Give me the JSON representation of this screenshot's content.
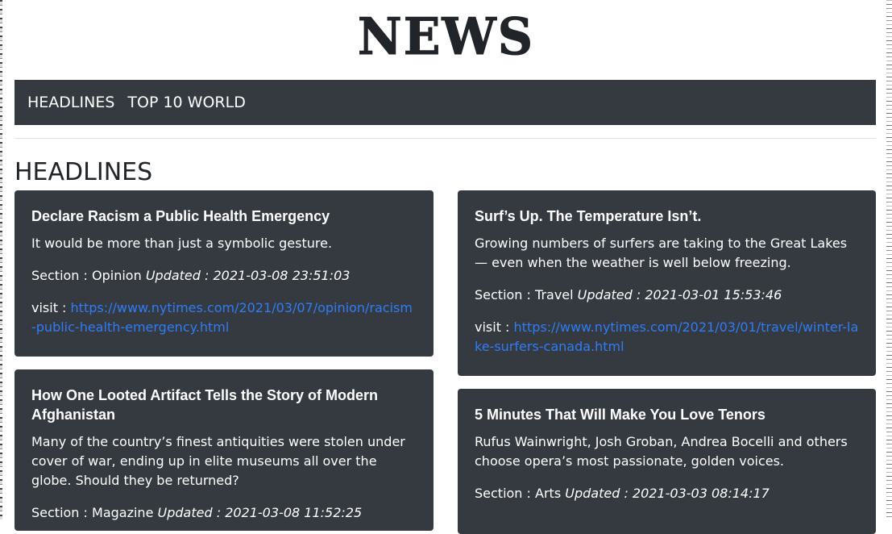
{
  "site": {
    "logo": "NEWS"
  },
  "nav": {
    "items": [
      "HEADLINES",
      "TOP 10 WORLD"
    ]
  },
  "page": {
    "title": "HEADLINES"
  },
  "labels": {
    "section_prefix": "Section : ",
    "updated_prefix": "Updated : ",
    "visit_prefix": "visit : "
  },
  "articles": [
    {
      "title": "Declare Racism a Public Health Emergency",
      "abstract": "It would be more than just a symbolic gesture.",
      "section": "Opinion",
      "updated": "2021-03-08 23:51:03",
      "url": "https://www.nytimes.com/2021/03/07/opinion/racism-public-health-emergency.html"
    },
    {
      "title": "Surf’s Up. The Temperature Isn’t.",
      "abstract": "Growing numbers of surfers are taking to the Great Lakes — even when the weather is well below freezing.",
      "section": "Travel",
      "updated": "2021-03-01 15:53:46",
      "url": "https://www.nytimes.com/2021/03/01/travel/winter-lake-surfers-canada.html"
    },
    {
      "title": "How One Looted Artifact Tells the Story of Modern Afghanistan",
      "abstract": "Many of the country’s finest antiquities were stolen under cover of war, ending up in elite museums all over the globe. Should they be returned?",
      "section": "Magazine",
      "updated": "2021-03-08 11:52:25"
    },
    {
      "title": "5 Minutes That Will Make You Love Tenors",
      "abstract": "Rufus Wainwright, Josh Groban, Andrea Bocelli and others choose opera’s most passionate, golden voices.",
      "section": "Arts",
      "updated": "2021-03-03 08:14:17"
    }
  ]
}
